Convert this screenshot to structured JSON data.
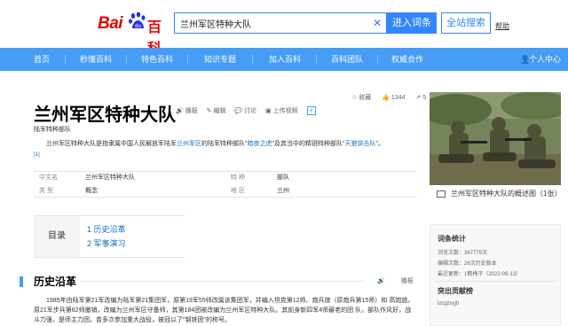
{
  "header": {
    "logo_text_bai": "Bai",
    "logo_text_du": "du",
    "logo_text_baike": "百科",
    "search_value": "兰州军区特种大队",
    "search_placeholder": "",
    "enter_entry_label": "进入词条",
    "full_search_label": "全站搜索",
    "help_label": "帮助"
  },
  "nav": {
    "items": [
      "首页",
      "秒懂百科",
      "特色百科",
      "知识专题",
      "加入百科",
      "百科团队",
      "权威合作"
    ],
    "user_label": "个人中心"
  },
  "article": {
    "title": "兰州军区特种大队",
    "tools": [
      "播报",
      "编辑",
      "讨论",
      "上传视频"
    ],
    "collect_label": "收藏",
    "collect_count": "1344",
    "like_count": "5",
    "subtitle": "陆军特种部队",
    "summary_parts": [
      "兰州军区特种大队是指隶属中国人民解放军陆军",
      "兰州军区",
      "的陆军特种部队\"",
      "暗夜之虎",
      "\"及其当中的精锐特种部队\"",
      "天狼突击队",
      "\"。"
    ],
    "summary_ref": "[1]",
    "info": [
      {
        "label": "中文名",
        "value": "兰州军区特种大队"
      },
      {
        "label": "特    种",
        "value": "部队"
      },
      {
        "label": "类    型",
        "value": "概念"
      },
      {
        "label": "地    区",
        "value": "兰州"
      }
    ],
    "toc_label": "目录",
    "toc_items": [
      "1  历史沿革",
      "2  军事演习"
    ],
    "section_title": "历史沿革",
    "section_tools": [
      "播报",
      "编辑"
    ],
    "body_line1": "1985年由陆军第21军改编为陆军第21集团军，原第19军55师改属该集团军，并编入坦克第12师、炮兵旅（原炮兵第15师）和",
    "body_line2": "高炮旅。原21军步兵第62师撤销，改编为兰州军区守备师，其第184团被改编为兰州军区特种大队。其前身新四军4师最老的团",
    "body_line3": "队，部队作风好，战斗力强，是师主力团，曾多次参加重大战役，被冠以了\"钢铁团\"的称号。"
  },
  "sidebar": {
    "caption": "兰州军区特种大队的概述图（1张）",
    "stats_title": "词条统计",
    "stats": [
      "浏览次数：367779次",
      "编辑次数：26次历史版本",
      "最近更新：1鹤梅子（2022-09-13）"
    ],
    "contrib_title": "突出贡献榜",
    "contrib_user": "lzcgzxyjh"
  },
  "colors": {
    "accent": "#3385ff",
    "nav_bg": "#459df5",
    "brand_red": "#e10601",
    "link": "#136ec2"
  }
}
